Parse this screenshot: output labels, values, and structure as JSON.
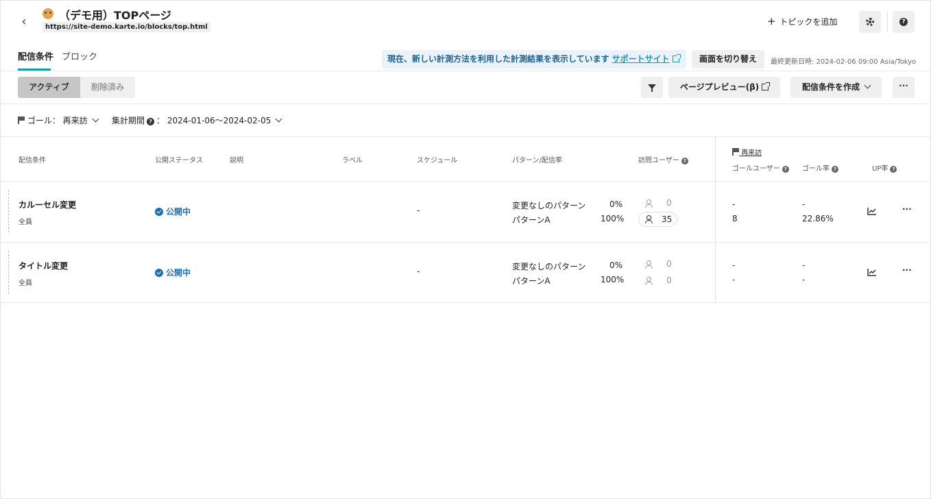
{
  "header": {
    "back_label": "‹",
    "title": "（デモ用）TOPページ",
    "url": "https://site-demo.karte.io/blocks/top.html",
    "add_topic_plus": "+",
    "add_topic_label": "トピックを追加",
    "help_label": "?"
  },
  "tabs": [
    {
      "label": "配信条件",
      "active": true
    },
    {
      "label": "ブロック",
      "active": false
    }
  ],
  "notice": {
    "text": "現在、新しい計測方法を利用した計測結果を表示しています",
    "link_label": "サポートサイト"
  },
  "switch_button": "画面を切り替え",
  "last_updated": "最終更新日時: 2024-02-06 09:00 Asia/Tokyo",
  "toolbar": {
    "segments": [
      "アクティブ",
      "削除済み"
    ],
    "preview_label": "ページプレビュー(β)",
    "create_label": "配信条件を作成",
    "more_label": "···"
  },
  "filters": {
    "goal_label": "ゴール：",
    "goal_value": "再来訪",
    "period_label": "集計期間",
    "period_qm": "?",
    "period_colon": "：",
    "period_value": "2024-01-06〜2024-02-05"
  },
  "table": {
    "columns": {
      "condition": "配信条件",
      "status": "公開ステータス",
      "description": "説明",
      "label": "ラベル",
      "schedule": "スケジュール",
      "pattern": "パターン/配信率",
      "visitors": "訪問ユーザー",
      "goal_group": "再来訪",
      "goal_users": "ゴールユーザー",
      "goal_rate": "ゴール率",
      "up_rate": "UP率"
    },
    "rows": [
      {
        "name": "カルーセル変更",
        "target": "全員",
        "status": "公開中",
        "schedule": "-",
        "patterns": [
          {
            "name": "変更なしのパターン",
            "rate": "0%",
            "visitors": "0",
            "goal_users": "-",
            "goal_rate": "-"
          },
          {
            "name": "パターンA",
            "rate": "100%",
            "visitors": "35",
            "goal_users": "8",
            "goal_rate": "22.86%"
          }
        ],
        "more": "···"
      },
      {
        "name": "タイトル変更",
        "target": "全員",
        "status": "公開中",
        "schedule": "-",
        "patterns": [
          {
            "name": "変更なしのパターン",
            "rate": "0%",
            "visitors": "0",
            "goal_users": "-",
            "goal_rate": "-"
          },
          {
            "name": "パターンA",
            "rate": "100%",
            "visitors": "0",
            "goal_users": "-",
            "goal_rate": "-"
          }
        ],
        "more": "···"
      }
    ]
  },
  "colors": {
    "accent": "#1a9aa8",
    "status_blue": "#1f6fb0",
    "notice_bg": "#eaf3fa"
  },
  "icons": [
    "back-arrow-icon",
    "logo-icon",
    "plus-icon",
    "gear-icon",
    "help-icon",
    "external-link-icon",
    "filter-icon",
    "chevron-down-icon",
    "flag-icon",
    "check-circle-icon",
    "person-icon",
    "line-chart-icon",
    "more-icon"
  ]
}
